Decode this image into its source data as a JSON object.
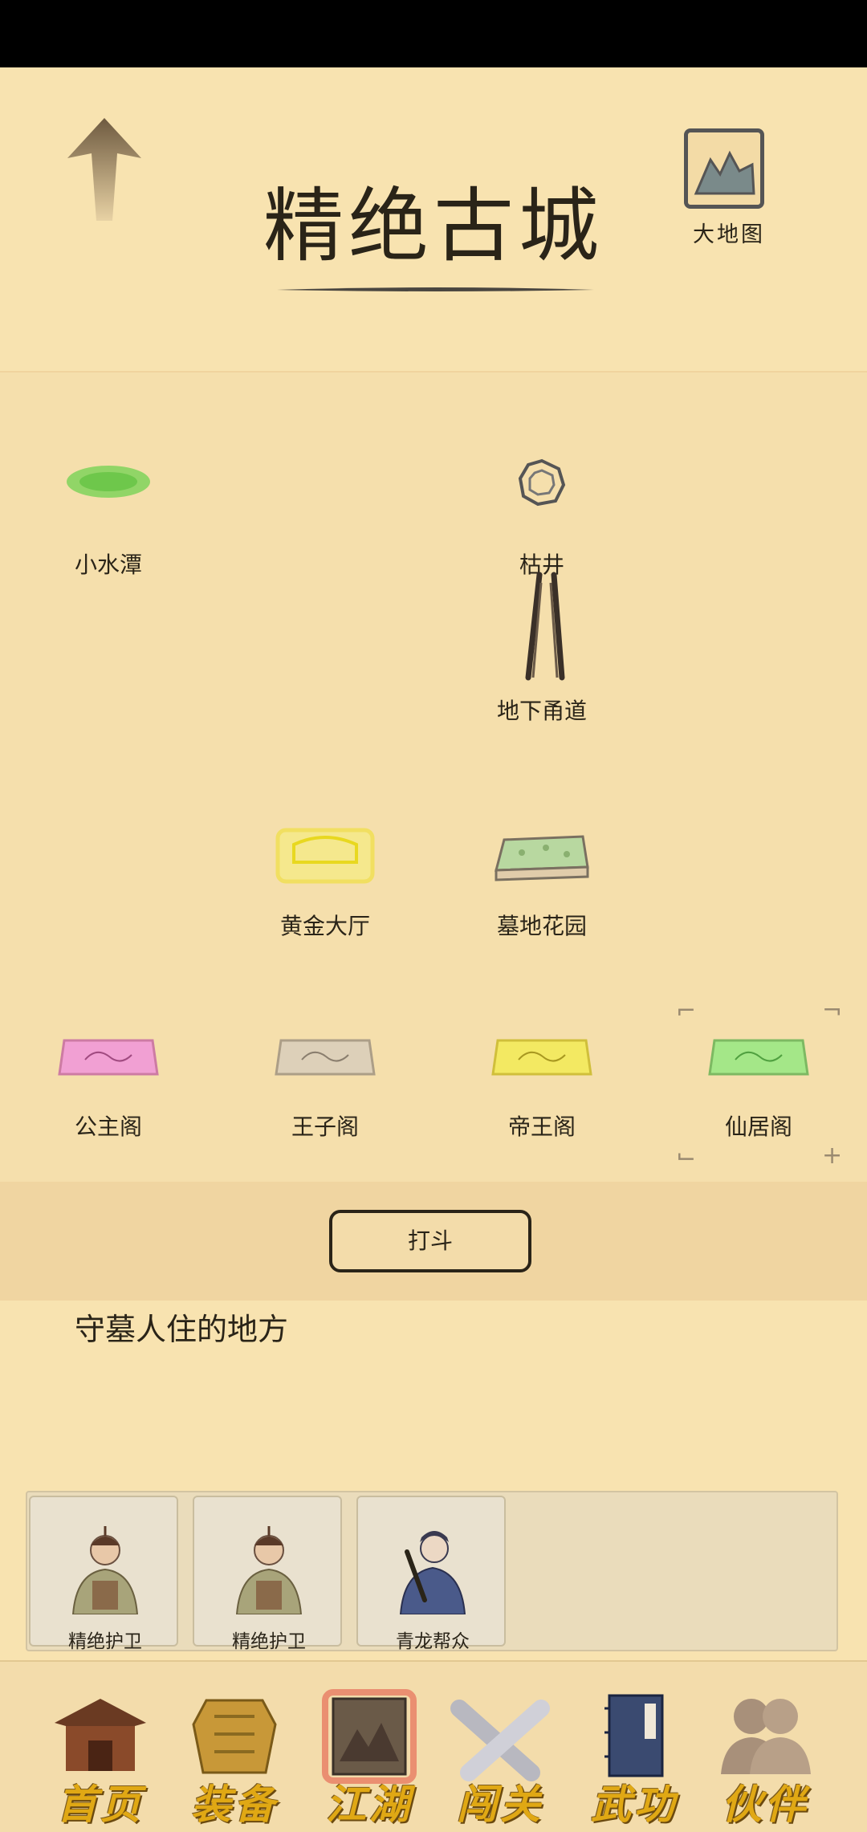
{
  "header": {
    "title": "精绝古城",
    "map_button_label": "大地图"
  },
  "locations": [
    {
      "name": "小水潭",
      "icon": "pond-icon"
    },
    {
      "name": "枯井",
      "icon": "well-icon"
    },
    {
      "name": "地下甬道",
      "icon": "tunnel-icon"
    },
    {
      "name": "黄金大厅",
      "icon": "golden-hall-icon"
    },
    {
      "name": "墓地花园",
      "icon": "cemetery-garden-icon"
    },
    {
      "name": "公主阁",
      "icon": "princess-pavilion-icon"
    },
    {
      "name": "王子阁",
      "icon": "prince-pavilion-icon"
    },
    {
      "name": "帝王阁",
      "icon": "emperor-pavilion-icon"
    },
    {
      "name": "仙居阁",
      "icon": "immortal-pavilion-icon"
    }
  ],
  "action": {
    "fight_label": "打斗"
  },
  "description": "守墓人住的地方",
  "npcs": [
    {
      "name": "精绝护卫",
      "icon": "guard-portrait"
    },
    {
      "name": "精绝护卫",
      "icon": "guard-portrait"
    },
    {
      "name": "青龙帮众",
      "icon": "gang-member-portrait"
    }
  ],
  "nav": [
    {
      "label": "首页",
      "icon": "house-icon"
    },
    {
      "label": "装备",
      "icon": "armor-icon"
    },
    {
      "label": "江湖",
      "icon": "scroll-map-icon"
    },
    {
      "label": "闯关",
      "icon": "crossed-swords-icon"
    },
    {
      "label": "武功",
      "icon": "book-icon"
    },
    {
      "label": "伙伴",
      "icon": "companions-icon"
    }
  ],
  "colors": {
    "background": "#f8e3b0",
    "text": "#2a2418",
    "nav_label": "#e0a814",
    "active_glow": "#e0302a"
  }
}
